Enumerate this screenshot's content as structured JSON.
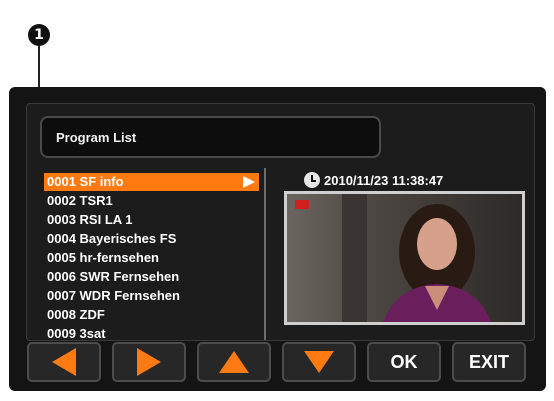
{
  "callout": {
    "number": "1"
  },
  "header": {
    "title": "Program List"
  },
  "channel_list": {
    "selected_index": 0,
    "items": [
      {
        "label": "0001 SF info"
      },
      {
        "label": "0002 TSR1"
      },
      {
        "label": "0003 RSI LA 1"
      },
      {
        "label": "0004 Bayerisches FS"
      },
      {
        "label": "0005 hr-fernsehen"
      },
      {
        "label": "0006 SWR Fernsehen"
      },
      {
        "label": "0007 WDR Fernsehen"
      },
      {
        "label": "0008 ZDF"
      },
      {
        "label": "0009 3sat"
      }
    ]
  },
  "info": {
    "datetime": "2010/11/23  11:38:47"
  },
  "buttons": {
    "left_icon": "left-arrow-icon",
    "right_icon": "right-arrow-icon",
    "up_icon": "up-arrow-icon",
    "down_icon": "down-arrow-icon",
    "ok_label": "OK",
    "exit_label": "EXIT"
  },
  "colors": {
    "accent": "#ff7a10",
    "background": "#141414",
    "text": "#ffffff"
  }
}
